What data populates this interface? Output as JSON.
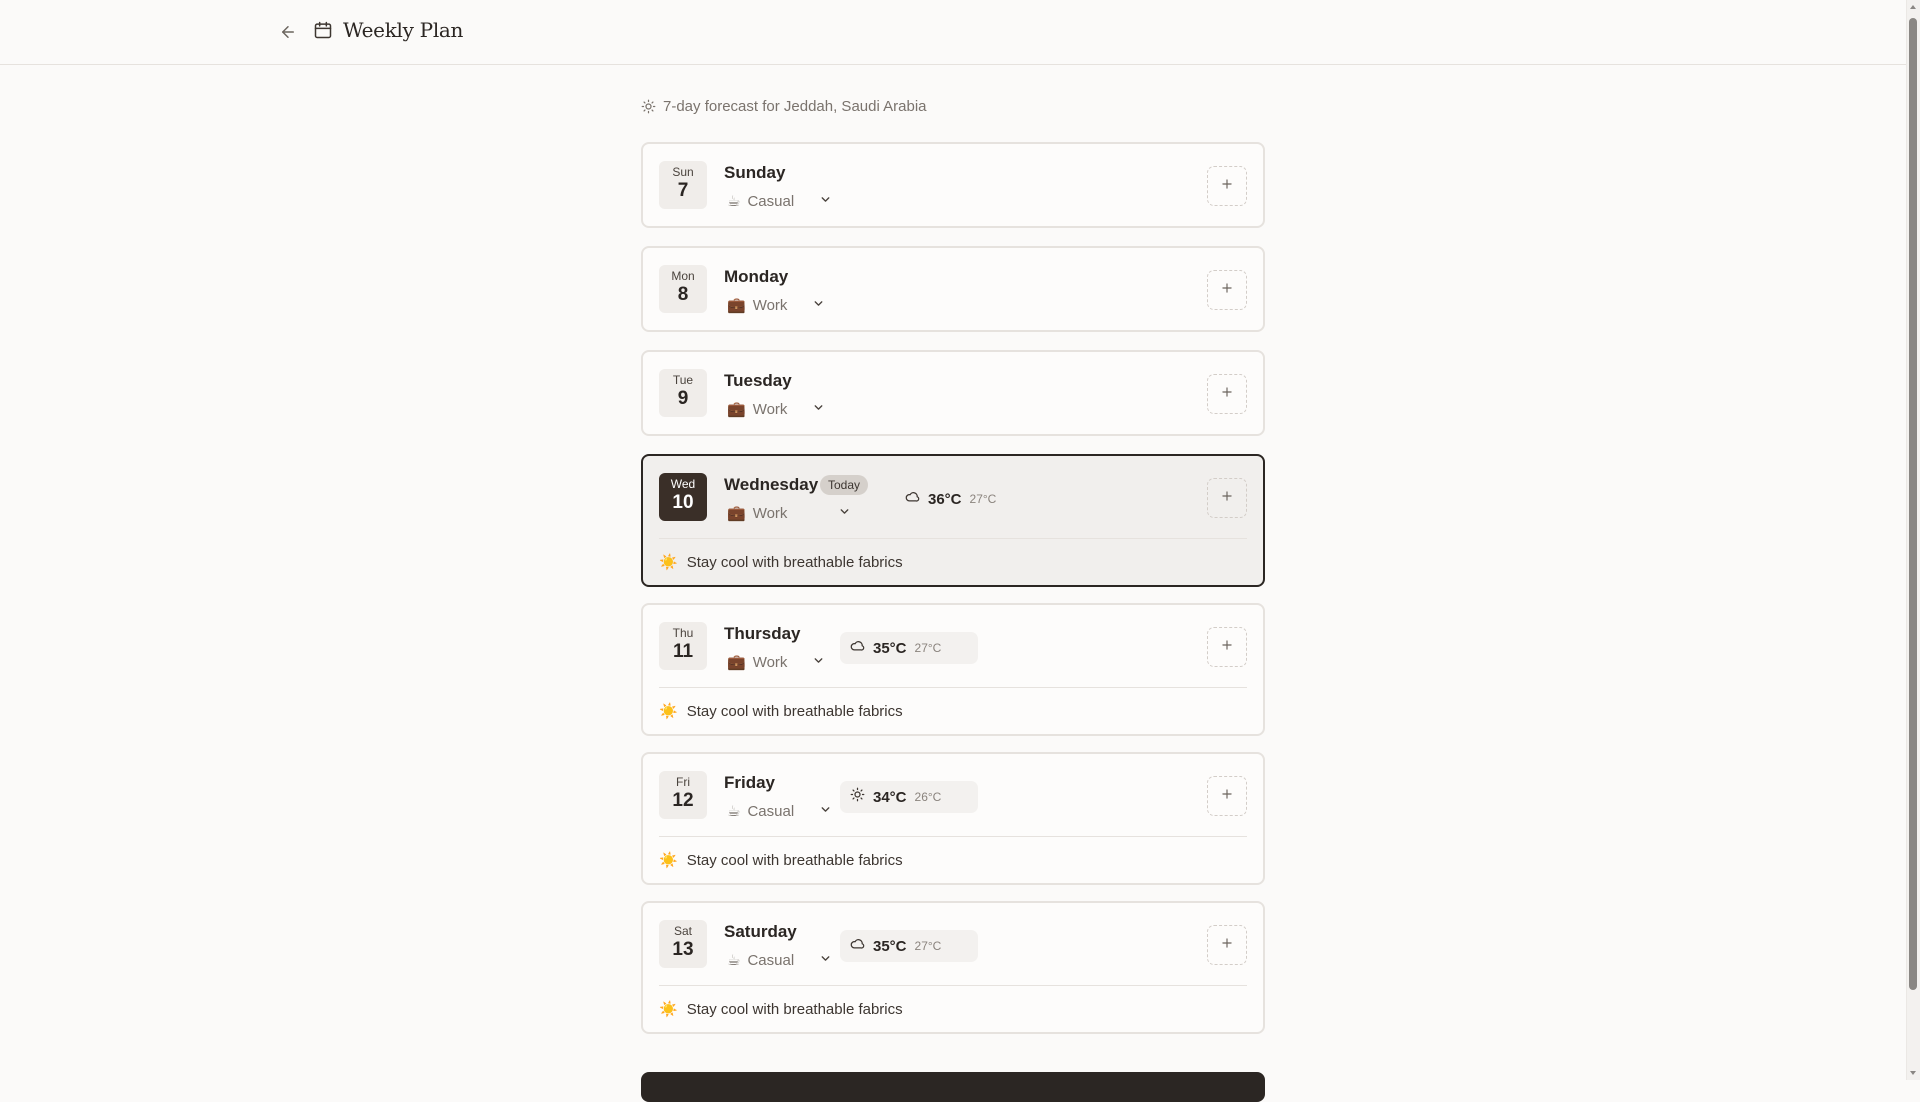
{
  "header": {
    "title": "Weekly Plan",
    "back_icon": "arrow-left-icon",
    "title_icon": "calendar-icon"
  },
  "forecast": {
    "text": "7-day forecast for Jeddah, Saudi Arabia",
    "icon": "sun-icon"
  },
  "colors": {
    "accent_dark": "#2b2623",
    "muted_text": "#7a736d",
    "card_border": "#e6e2de",
    "tip_sun": "#f5a623"
  },
  "days": [
    {
      "dow": "Sun",
      "num": "7",
      "name": "Sunday",
      "occasion_emoji": "☕",
      "occasion": "Casual"
    },
    {
      "dow": "Mon",
      "num": "8",
      "name": "Monday",
      "occasion_emoji": "💼",
      "occasion": "Work"
    },
    {
      "dow": "Tue",
      "num": "9",
      "name": "Tuesday",
      "occasion_emoji": "💼",
      "occasion": "Work"
    },
    {
      "dow": "Wed",
      "num": "10",
      "name": "Wednesday",
      "badge": "Today",
      "occasion_emoji": "💼",
      "occasion": "Work",
      "weather_icon": "cloud-icon",
      "high": "36°C",
      "low": "27°C",
      "tip_emoji": "☀️",
      "tip": "Stay cool with breathable fabrics"
    },
    {
      "dow": "Thu",
      "num": "11",
      "name": "Thursday",
      "occasion_emoji": "💼",
      "occasion": "Work",
      "weather_icon": "cloud-icon",
      "high": "35°C",
      "low": "27°C",
      "tip_emoji": "☀️",
      "tip": "Stay cool with breathable fabrics"
    },
    {
      "dow": "Fri",
      "num": "12",
      "name": "Friday",
      "occasion_emoji": "☕",
      "occasion": "Casual",
      "weather_icon": "sun-icon",
      "high": "34°C",
      "low": "26°C",
      "tip_emoji": "☀️",
      "tip": "Stay cool with breathable fabrics"
    },
    {
      "dow": "Sat",
      "num": "13",
      "name": "Saturday",
      "occasion_emoji": "☕",
      "occasion": "Casual",
      "weather_icon": "cloud-icon",
      "high": "35°C",
      "low": "27°C",
      "tip_emoji": "☀️",
      "tip": "Stay cool with breathable fabrics"
    }
  ]
}
